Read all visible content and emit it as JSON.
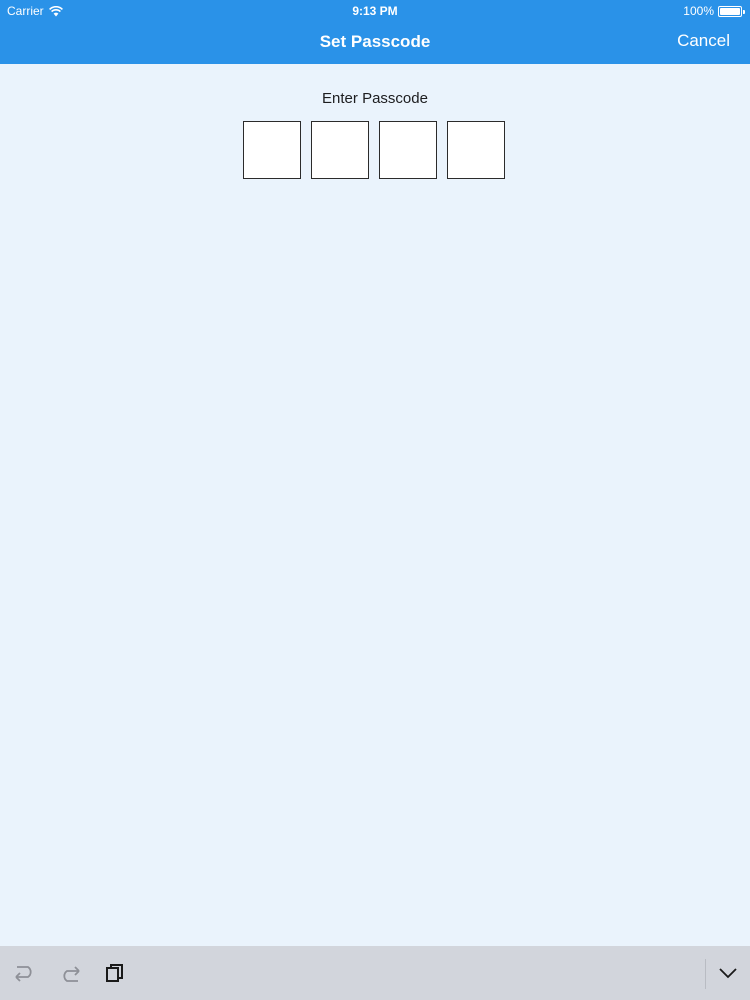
{
  "status_bar": {
    "carrier": "Carrier",
    "time": "9:13 PM",
    "battery": "100%"
  },
  "nav": {
    "title": "Set Passcode",
    "cancel_label": "Cancel"
  },
  "content": {
    "prompt": "Enter Passcode",
    "digits": [
      "",
      "",
      "",
      ""
    ]
  },
  "shortcut_bar": {
    "icons": [
      "undo-icon",
      "redo-icon",
      "paste-icon",
      "dismiss-keyboard-icon"
    ]
  },
  "colors": {
    "nav_background": "#2a92e8",
    "page_background": "#eaf3fc",
    "shortcut_bar_background": "#d2d5dc"
  }
}
